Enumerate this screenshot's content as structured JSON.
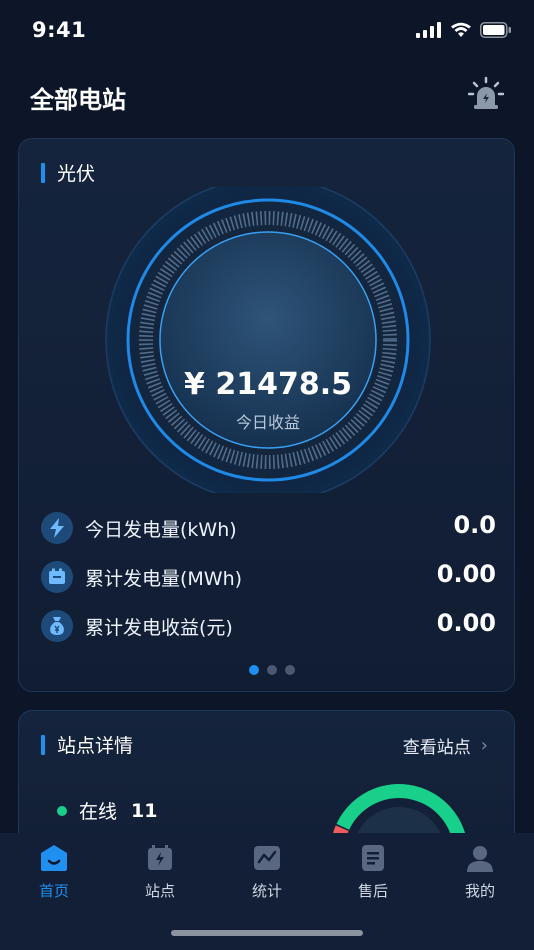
{
  "status_bar": {
    "time": "9:41"
  },
  "header": {
    "title": "全部电站"
  },
  "pv_card": {
    "title": "光伏",
    "today_revenue_value": "¥ 21478.5",
    "today_revenue_label": "今日收益",
    "metrics": [
      {
        "icon": "lightning-icon",
        "label": "今日发电量(kWh)",
        "value": "0.0"
      },
      {
        "icon": "battery-icon",
        "label": "累计发电量(MWh)",
        "value": "0.00"
      },
      {
        "icon": "money-bag-icon",
        "label": "累计发电收益(元)",
        "value": "0.00"
      }
    ],
    "pager": {
      "pages": 3,
      "active": 1
    }
  },
  "station_card": {
    "title": "站点详情",
    "view_link": "查看站点",
    "online_label": "在线",
    "online_count": "11"
  },
  "tabbar": {
    "items": [
      {
        "label": "首页",
        "icon": "home-icon",
        "active": true
      },
      {
        "label": "站点",
        "icon": "station-icon",
        "active": false
      },
      {
        "label": "统计",
        "icon": "chart-icon",
        "active": false
      },
      {
        "label": "售后",
        "icon": "service-icon",
        "active": false
      },
      {
        "label": "我的",
        "icon": "profile-icon",
        "active": false
      }
    ]
  },
  "colors": {
    "accent": "#1f8ff0",
    "online": "#19d08b",
    "background": "#0d1628"
  }
}
